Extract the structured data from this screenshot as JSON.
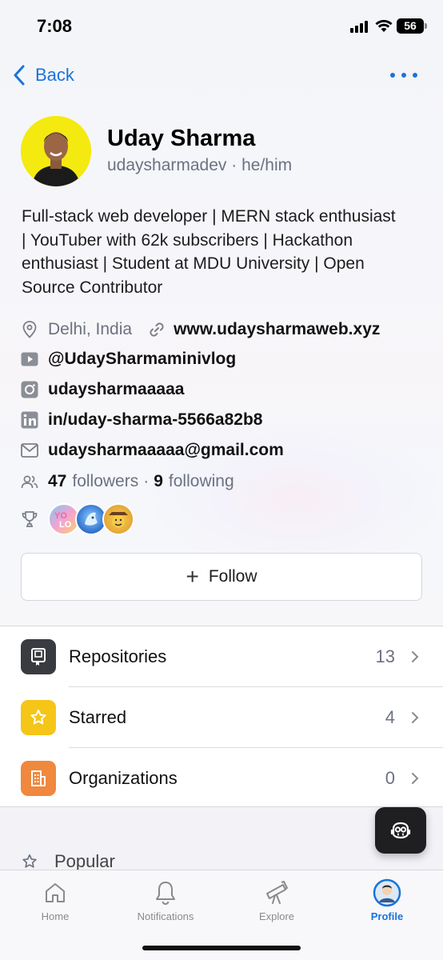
{
  "status_bar": {
    "time": "7:08",
    "battery": "56"
  },
  "nav": {
    "back_label": "Back"
  },
  "profile": {
    "name": "Uday Sharma",
    "username": "udaysharmadev",
    "pronouns": "he/him",
    "handle_separator": "·",
    "bio": "Full-stack web developer | MERN stack enthusiast | YouTuber with 62k subscribers | Hackathon enthusiast | Student at MDU University | Open Source Contributor",
    "location": "Delhi, India",
    "website": "www.udaysharmaweb.xyz",
    "youtube": "@UdaySharmaminivlog",
    "instagram": "udaysharmaaaaa",
    "linkedin": "in/uday-sharma-5566a82b8",
    "email": "udaysharmaaaaa@gmail.com",
    "followers_count": "47",
    "followers_label": "followers",
    "separator": "·",
    "following_count": "9",
    "following_label": "following",
    "achievement_icons": [
      "yolo-badge-icon",
      "pull-shark-badge-icon",
      "quickdraw-badge-icon"
    ]
  },
  "follow_button": {
    "label": "Follow"
  },
  "list": [
    {
      "label": "Repositories",
      "count": "13",
      "icon": "repo-icon",
      "color": "#3a3b40"
    },
    {
      "label": "Starred",
      "count": "4",
      "icon": "star-icon",
      "color": "#f5c518"
    },
    {
      "label": "Organizations",
      "count": "0",
      "icon": "organization-icon",
      "color": "#f0883e"
    }
  ],
  "popular": {
    "label": "Popular"
  },
  "tabs": [
    {
      "label": "Home",
      "icon": "home-icon",
      "active": false
    },
    {
      "label": "Notifications",
      "icon": "bell-icon",
      "active": false
    },
    {
      "label": "Explore",
      "icon": "telescope-icon",
      "active": false
    },
    {
      "label": "Profile",
      "icon": "profile-avatar-icon",
      "active": true
    }
  ],
  "colors": {
    "accent": "#1a73d9",
    "avatar_bg": "#f4ea0f"
  }
}
